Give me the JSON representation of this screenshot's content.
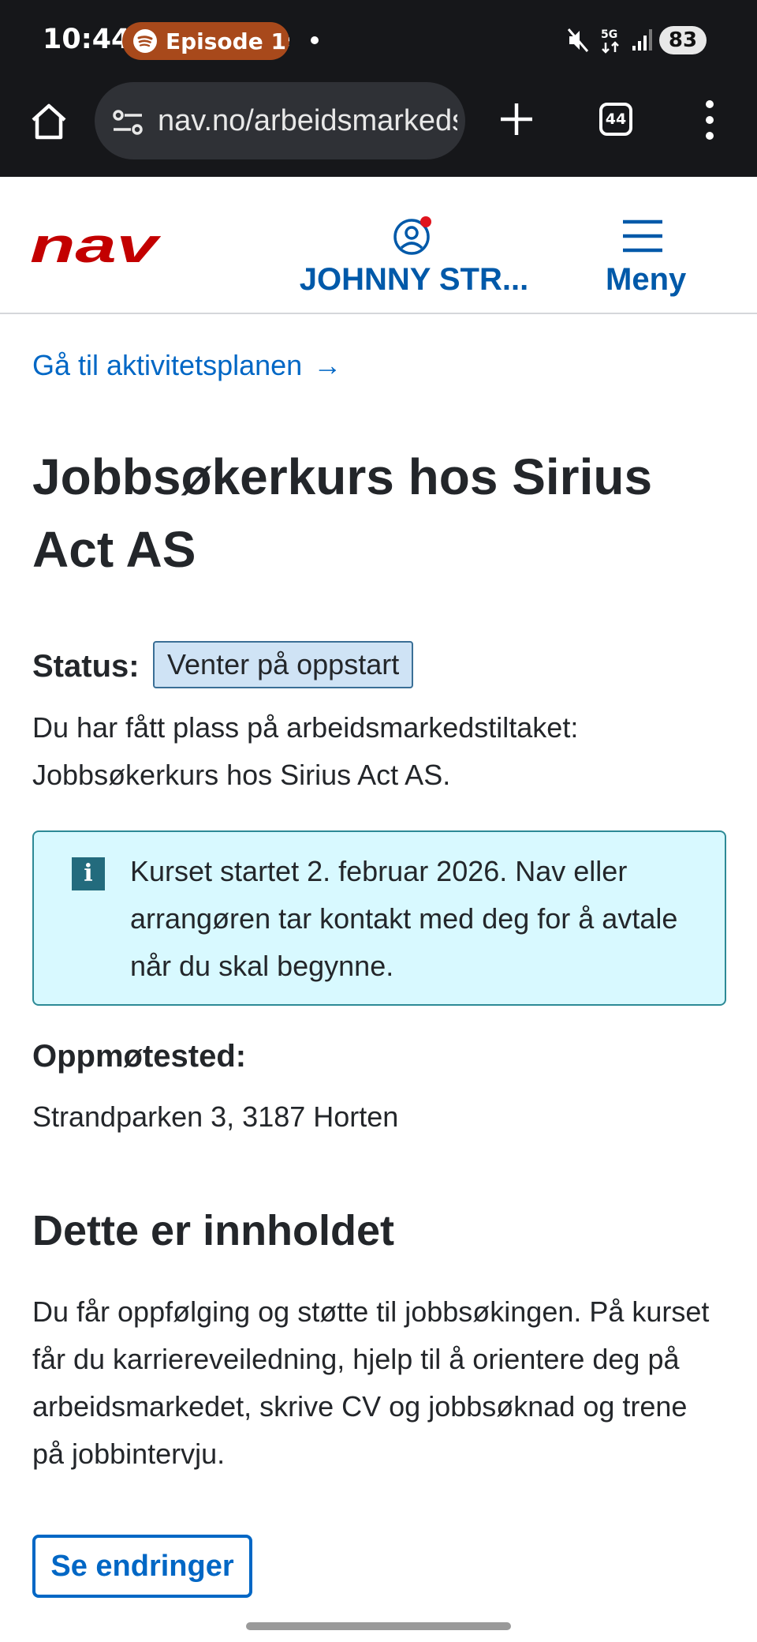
{
  "status_bar": {
    "time": "10:44",
    "media_label": "Episode 1:",
    "battery": "83"
  },
  "browser": {
    "url": "nav.no/arbeidsmarkedstiltak",
    "tab_count": "44"
  },
  "header": {
    "logo_text": "nav",
    "user_name": "JOHNNY STR...",
    "menu_label": "Meny"
  },
  "main": {
    "back_link": "Gå til aktivitetsplanen",
    "back_arrow": "→",
    "title": "Jobbsøkerkurs hos Sirius Act AS",
    "status_label": "Status:",
    "status_value": "Venter på oppstart",
    "status_description": "Du har fått plass på arbeidsmarkedstiltaket: Jobbsøkerkurs hos Sirius Act AS.",
    "info_icon": "i",
    "info_text": "Kurset startet 2. februar 2026. Nav eller arrangøren tar kontakt med deg for å avtale når du skal begynne.",
    "venue_label": "Oppmøtested:",
    "venue_value": "Strandparken 3, 3187 Horten",
    "section_title": "Dette er innholdet",
    "section_text": "Du får oppfølging og støtte til jobbsøkingen. På kurset får du karriereveiledning, hjelp til å orientere deg på arbeidsmarkedet, skrive CV og jobbsøknad og trene på jobbintervju.",
    "changes_button": "Se endringer"
  },
  "colors": {
    "brand_red": "#c30000",
    "link_blue": "#0067c5",
    "header_blue": "#0059a9",
    "info_bg": "#d8f9ff",
    "badge_bg": "#cfe3f5"
  },
  "icons": [
    "spotify-icon",
    "mute-icon",
    "5g-icon",
    "signal-icon",
    "home-icon",
    "tune-icon",
    "plus-icon",
    "tabs-icon",
    "more-vert-icon",
    "user-icon",
    "notification-dot-icon",
    "hamburger-icon",
    "info-icon",
    "arrow-right-icon"
  ]
}
